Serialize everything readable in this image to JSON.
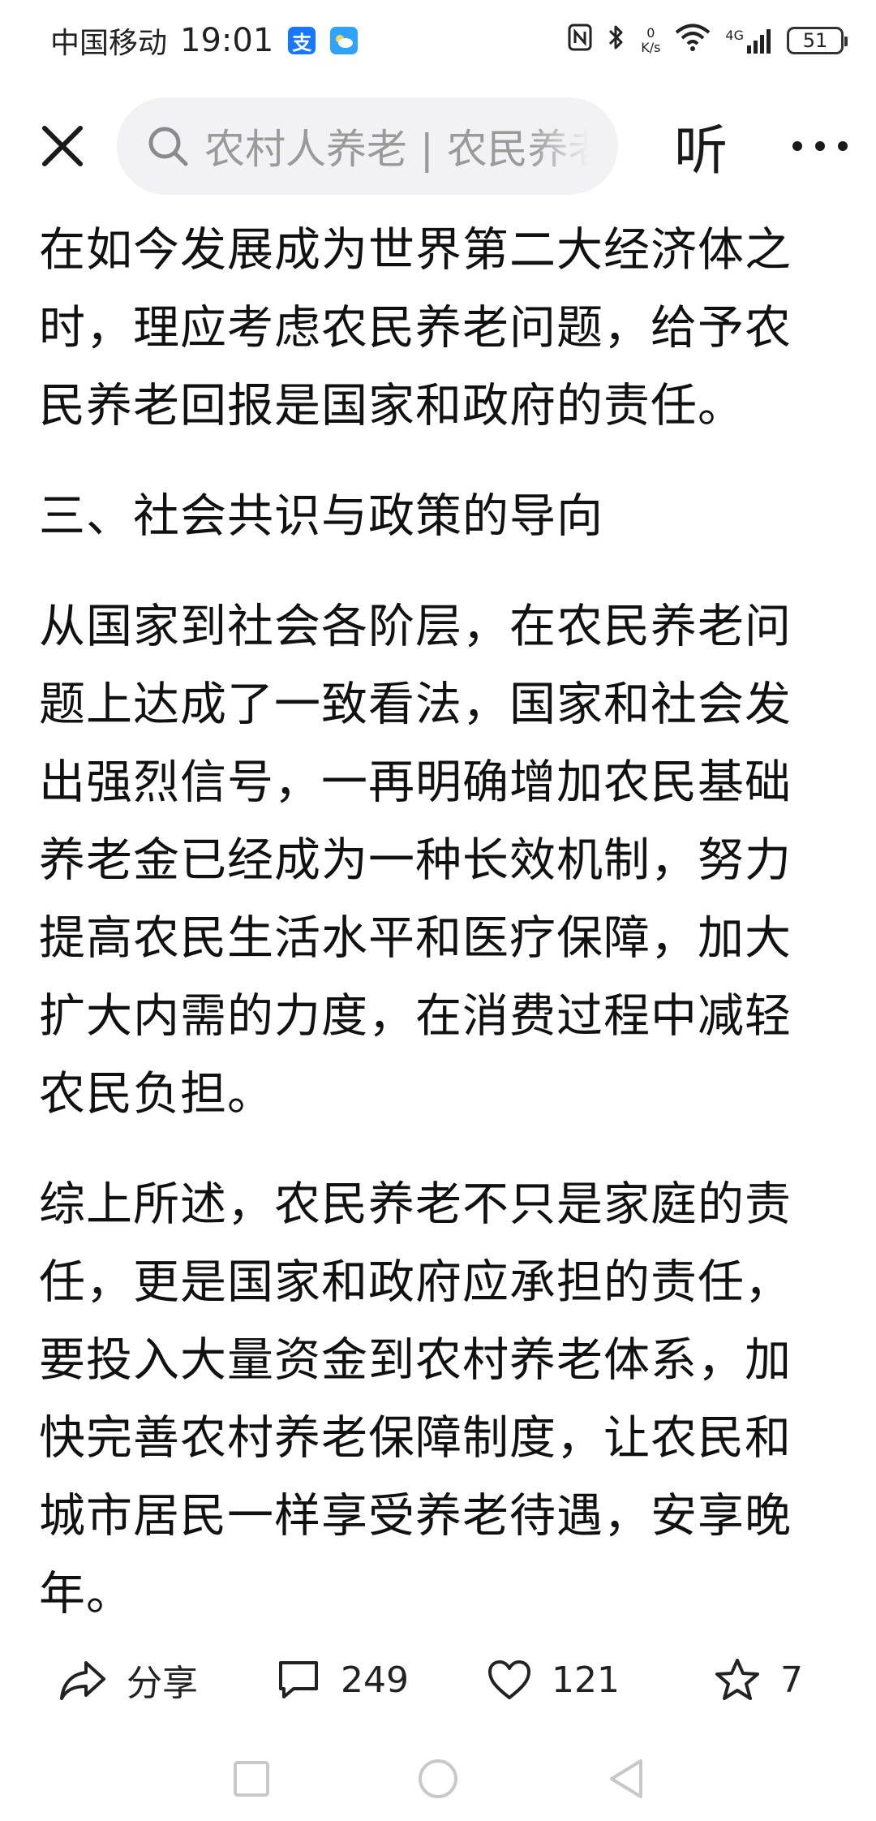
{
  "status_bar": {
    "carrier": "中国移动",
    "time": "19:01",
    "app_badges": [
      {
        "icon": "alipay-icon",
        "glyph": "支",
        "color": "#1677ff"
      },
      {
        "icon": "weather-icon",
        "glyph": "",
        "color": "#2fa4ff"
      }
    ],
    "net_speed_value": "0",
    "net_speed_unit": "K/s",
    "network_type": "4G",
    "battery": "51"
  },
  "top_bar": {
    "search_text": "农村人养老 | 农民养老",
    "listen_label": "听"
  },
  "article": {
    "paragraphs": [
      "在如今发展成为世界第二大经济体之时，理应考虑农民养老问题，给予农民养老回报是国家和政府的责任。",
      "三、社会共识与政策的导向",
      "从国家到社会各阶层，在农民养老问题上达成了一致看法，国家和社会发出强烈信号，一再明确增加农民基础养老金已经成为一种长效机制，努力提高农民生活水平和医疗保障，加大扩大内需的力度，在消费过程中减轻农民负担。",
      "综上所述，农民养老不只是家庭的责任，更是国家和政府应承担的责任，要投入大量资金到农村养老体系，加快完善农村养老保障制度，让农民和城市居民一样享受养老待遇，安享晚年。"
    ]
  },
  "actions": {
    "share_label": "分享",
    "comment_count": "249",
    "like_count": "121",
    "favorite_count": "7"
  },
  "colors": {
    "text": "#111111",
    "search_bg": "#f2f2f4",
    "placeholder": "#9a9a9a",
    "nav_icon": "#c8c8c8"
  }
}
